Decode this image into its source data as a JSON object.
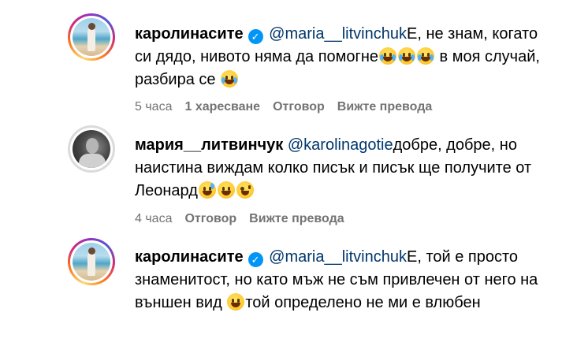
{
  "comments": [
    {
      "username": "каролинасите",
      "verified": true,
      "mention": "@maria__litvinchuk",
      "text_part1": "Е, не знам, когато си дядо, нивото няма да помогне",
      "emoji_group1": [
        "tears-of-joy",
        "tears-of-joy",
        "tears-of-joy"
      ],
      "text_part2": " в моя случай, разбира се ",
      "emoji_group2": [
        "tears-of-joy"
      ],
      "time": "5 часа",
      "likes": "1 харесване",
      "reply": "Отговор",
      "translate": "Вижте превода"
    },
    {
      "username": "мария__литвинчук",
      "verified": false,
      "mention": "@karolinagotie",
      "text_part1": "добре, добре, но наистина виждам колко писък и писък ще получите от Леонард",
      "emoji_group1": [
        "grinning-sweat",
        "grinning",
        "zany"
      ],
      "time": "4 часа",
      "reply": "Отговор",
      "translate": "Вижте превода"
    },
    {
      "username": "каролинасите",
      "verified": true,
      "mention": "@maria__litvinchuk",
      "text_part1": "Е, той е просто знаменитост, но като мъж не съм привлечен от него на външен вид ",
      "emoji_group1": [
        "grinning"
      ],
      "text_part2": "той определено не ми е влюбен"
    }
  ],
  "colors": {
    "mention": "#00376b",
    "meta": "#737373",
    "verified": "#0095f6"
  }
}
